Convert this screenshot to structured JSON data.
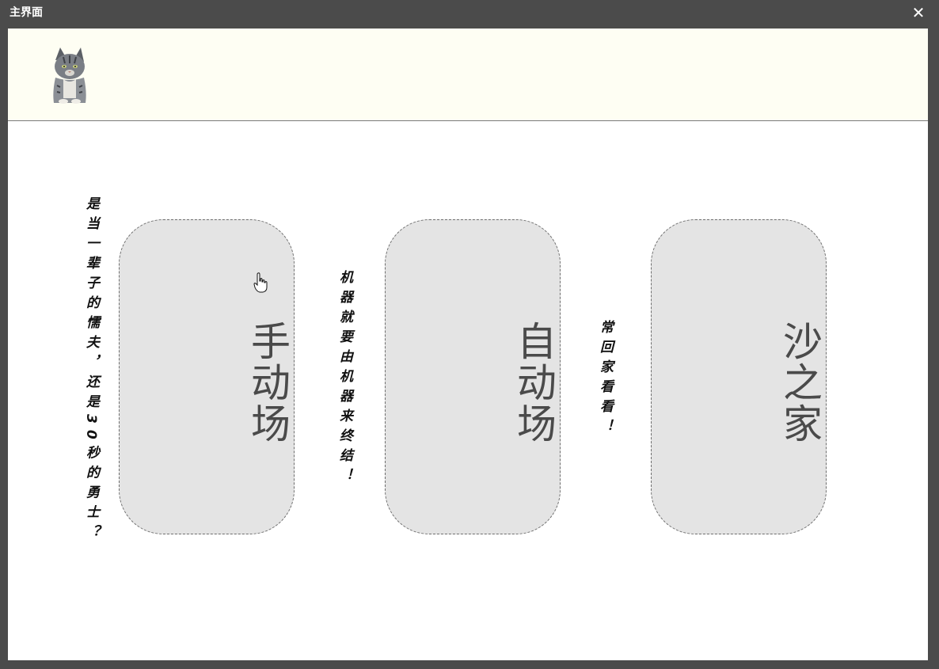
{
  "window": {
    "title": "主界面",
    "close_glyph": "✕"
  },
  "header": {
    "avatar_icon": "cat-avatar-icon"
  },
  "taglines": [
    "是当一辈子的懦夫，还是30秒的勇士？",
    "机器就要由机器来终结！",
    "常回家看看！"
  ],
  "modes": [
    {
      "label": "手动场"
    },
    {
      "label": "自动场"
    },
    {
      "label": "沙之家"
    }
  ],
  "colors": {
    "titlebar": "#4b4b4b",
    "header_band": "#fefef3",
    "card_fill": "#e4e4e4",
    "card_text": "#4a4a4a"
  }
}
